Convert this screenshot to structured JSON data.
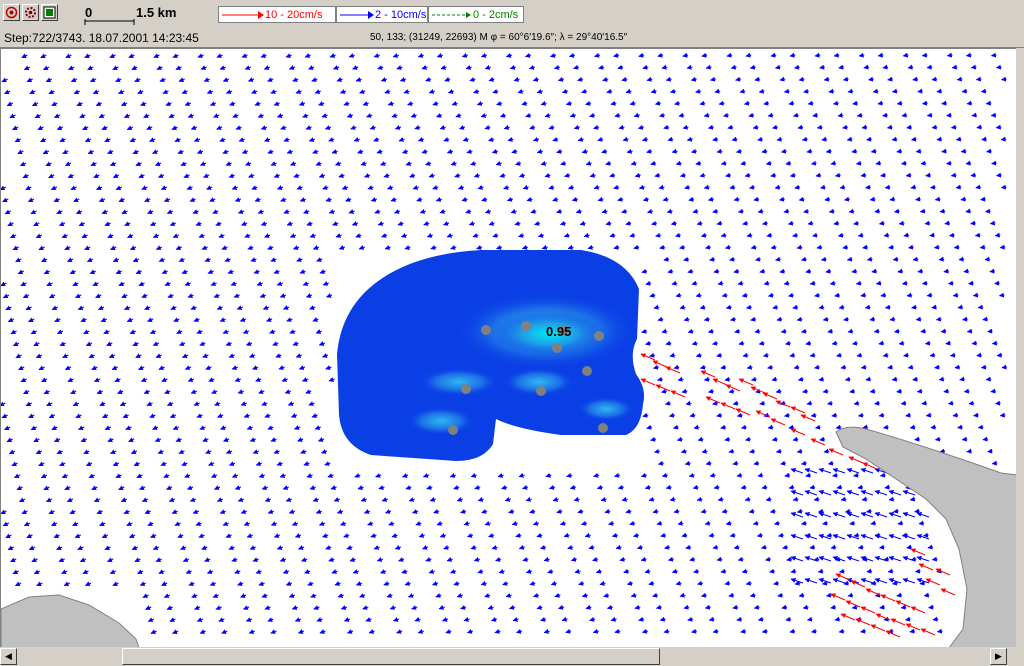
{
  "toolbar": {
    "buttons": [
      {
        "name": "target-icon"
      },
      {
        "name": "gear-icon"
      },
      {
        "name": "map-view-icon"
      }
    ],
    "scale_zero": "0",
    "scale_label": "1.5 km"
  },
  "legend": [
    {
      "label": "10 - 20cm/s",
      "color": "#ff0000",
      "style": "solid"
    },
    {
      "label": "2 - 10cm/s",
      "color": "#0000ff",
      "style": "solid"
    },
    {
      "label": "0 - 2cm/s",
      "color": "#008000",
      "style": "dashed"
    }
  ],
  "status": {
    "step": "Step:722/3743. 18.07.2001 14:23:45",
    "coords": "50, 133;  (31249, 22693) M  φ = 60°6′19.6″;  λ = 29°40′16.5″"
  },
  "map": {
    "concentration_label": "0.95",
    "colors": {
      "water": "#ffffff",
      "land": "#c0c0c0",
      "plume_outer": "#0a3fe6",
      "plume_mid": "#1e78e8",
      "plume_core": "#00d8f0",
      "vector_medium": "#0000ff",
      "vector_strong": "#ff0000",
      "station": "#808080"
    }
  }
}
